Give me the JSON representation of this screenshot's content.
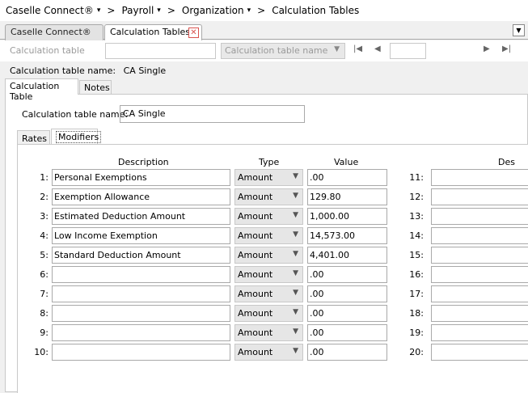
{
  "breadcrumb": {
    "items": [
      "Caselle Connect®",
      "Payroll",
      "Organization",
      "Calculation Tables"
    ],
    "separator": ">"
  },
  "tabs": [
    {
      "label": "Caselle Connect®"
    },
    {
      "label": "Calculation Tables"
    }
  ],
  "toolbar": {
    "label": "Calculation table",
    "select_placeholder": "Calculation table name"
  },
  "info": {
    "label": "Calculation table name:",
    "value": "CA Single"
  },
  "subtabs": [
    "Calculation Table",
    "Notes"
  ],
  "form": {
    "name_label": "Calculation table name:",
    "name_value": "CA Single"
  },
  "inner_tabs": [
    "Rates",
    "Modifiers"
  ],
  "modifiers": {
    "headers": {
      "description": "Description",
      "type": "Type",
      "value": "Value",
      "description2": "Des"
    },
    "rows": [
      {
        "num": "1:",
        "description": "Personal Exemptions",
        "type": "Amount",
        "value": ".00"
      },
      {
        "num": "2:",
        "description": "Exemption Allowance",
        "type": "Amount",
        "value": "129.80"
      },
      {
        "num": "3:",
        "description": "Estimated Deduction Amount",
        "type": "Amount",
        "value": "1,000.00"
      },
      {
        "num": "4:",
        "description": "Low Income Exemption",
        "type": "Amount",
        "value": "14,573.00"
      },
      {
        "num": "5:",
        "description": "Standard Deduction Amount",
        "type": "Amount",
        "value": "4,401.00"
      },
      {
        "num": "6:",
        "description": "",
        "type": "Amount",
        "value": ".00"
      },
      {
        "num": "7:",
        "description": "",
        "type": "Amount",
        "value": ".00"
      },
      {
        "num": "8:",
        "description": "",
        "type": "Amount",
        "value": ".00"
      },
      {
        "num": "9:",
        "description": "",
        "type": "Amount",
        "value": ".00"
      },
      {
        "num": "10:",
        "description": "",
        "type": "Amount",
        "value": ".00"
      }
    ],
    "right_nums": [
      "11:",
      "12:",
      "13:",
      "14:",
      "15:",
      "16:",
      "17:",
      "18:",
      "19:",
      "20:"
    ]
  }
}
